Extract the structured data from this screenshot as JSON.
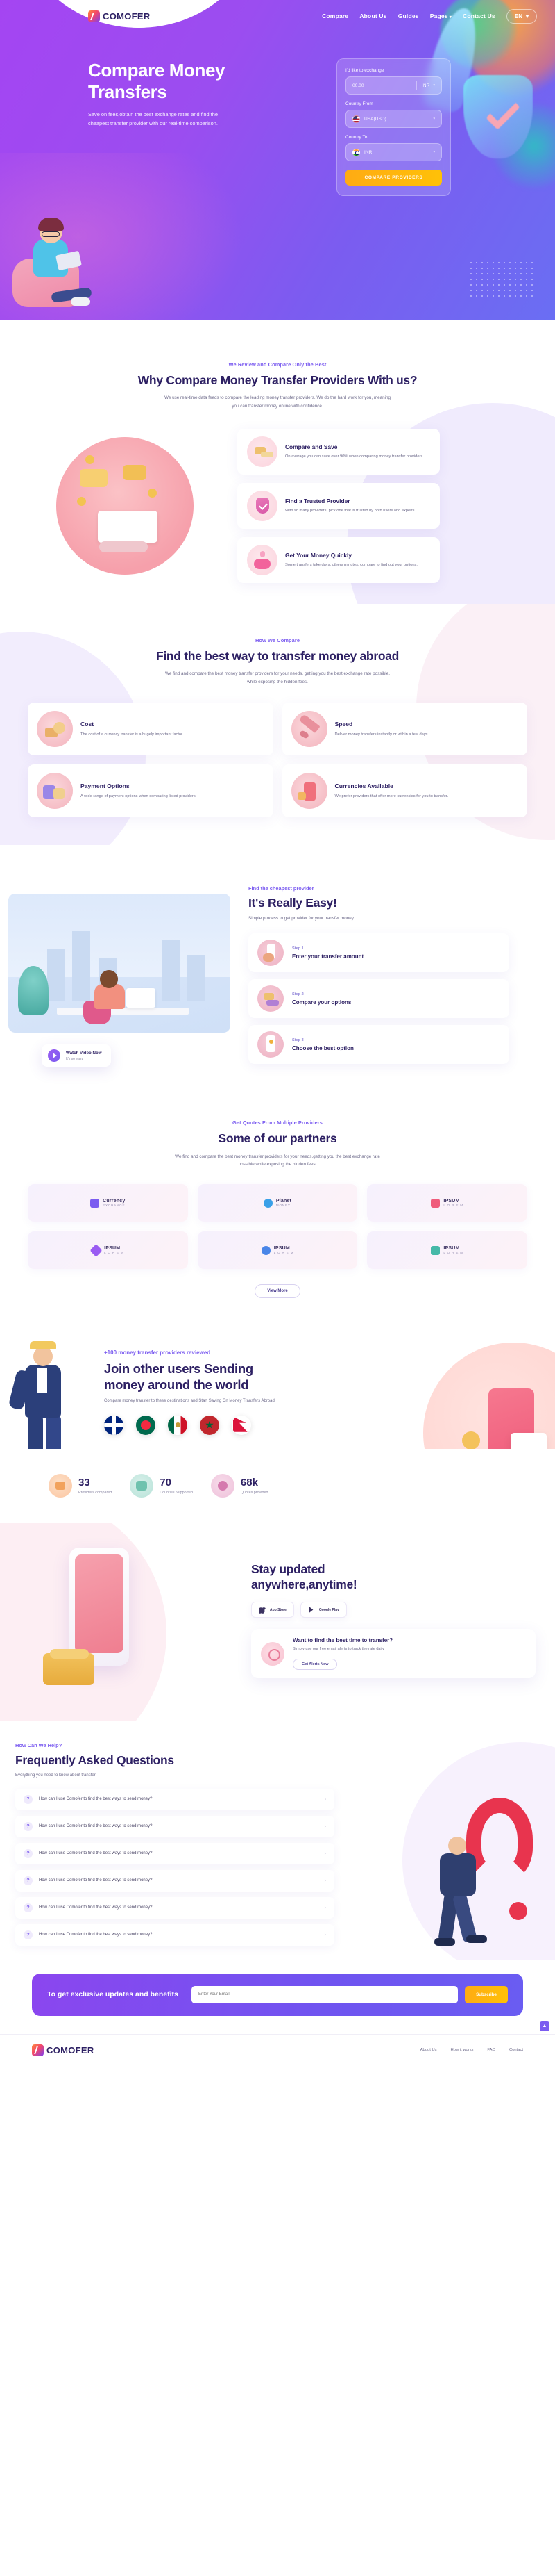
{
  "brand": {
    "name": "COMOFER"
  },
  "nav": {
    "links": [
      {
        "label": "Compare",
        "caret": false
      },
      {
        "label": "About Us",
        "caret": false
      },
      {
        "label": "Guides",
        "caret": false
      },
      {
        "label": "Pages",
        "caret": true
      },
      {
        "label": "Contact Us",
        "caret": false
      }
    ],
    "language": "EN",
    "language_caret": "▾"
  },
  "hero": {
    "title_line1": "Compare Money",
    "title_line2": "Transfers",
    "subtitle": "Save on fees,obtain the best exchange rates and find the cheapest transfer provider with our real-time comparison.",
    "form": {
      "exchange_label": "I'd like to exchange",
      "amount_value": "00.00",
      "amount_currency": "INR",
      "country_from_label": "Country From",
      "country_from_value": "USA(USD)",
      "country_to_label": "Country To",
      "country_to_value": "INR",
      "submit_label": "COMPARE PROVIDERS"
    }
  },
  "why": {
    "eyebrow": "We Review and Compare Only the Best",
    "title": "Why Compare Money Transfer Providers With us?",
    "lead": "We use real-time data feeds to compare the leading money transfer providers. We do the hard work for you, meaning you can transfer money online with confidence.",
    "cards": [
      {
        "title": "Compare and Save",
        "desc": "On average you can save over 90% when comparing money transfer providers.",
        "icon": "coins-icon"
      },
      {
        "title": "Find a Trusted Provider",
        "desc": "With so many providers, pick one that is trusted by both users and experts.",
        "icon": "shield-check-icon"
      },
      {
        "title": "Get Your Money Quickly",
        "desc": "Some transfers take days, others minutes, compare to find out your options.",
        "icon": "piggy-bank-icon"
      }
    ]
  },
  "how": {
    "eyebrow": "How We Compare",
    "title": "Find the best way to transfer money abroad",
    "lead": "We find and compare the best money transfer providers for your needs, getting you the best exchange rate possible, while exposing the hidden fees.",
    "cards": [
      {
        "title": "Cost",
        "desc": "The cost of a currency transfer is a hugely important factor",
        "icon": "coin-stack-icon"
      },
      {
        "title": "Speed",
        "desc": "Deliver money transfers instantly or within a few days.",
        "icon": "rocket-icon"
      },
      {
        "title": "Payment Options",
        "desc": "A wide range of payment options when comparing listed providers.",
        "icon": "wallet-icon"
      },
      {
        "title": "Currencies Available",
        "desc": "We prefer providers that offer more currencies for you to transfer.",
        "icon": "currency-icon"
      }
    ]
  },
  "easy": {
    "eyebrow": "Find the cheapest provider",
    "title": "It's Really Easy!",
    "lead": "Simple process to get provider for your transfer money",
    "video": {
      "title": "Watch Video Now",
      "subtitle": "It's so easy"
    },
    "steps": [
      {
        "num": "Step 1",
        "title": "Enter your transfer amount"
      },
      {
        "num": "Step 2",
        "title": "Compare your options"
      },
      {
        "num": "Step 3",
        "title": "Choose the best option"
      }
    ]
  },
  "partners": {
    "eyebrow": "Get Quotes From Multiple Providers",
    "title": "Some of our partners",
    "lead": "We find and compare the best money transfer providers for your needs,getting you the best exchange rate possible,while exposing the hidden fees.",
    "logos": [
      {
        "name": "Currency",
        "sub": "EXCHANGE",
        "color": "#7b5cf0"
      },
      {
        "name": "Planet",
        "sub": "MONEY",
        "color": "#3aa0e8"
      },
      {
        "name": "IPSUM",
        "sub": "L O R E M",
        "color": "#ef5c7b"
      },
      {
        "name": "IPSUM",
        "sub": "L O R E M",
        "color": "#9a5cf2"
      },
      {
        "name": "IPSUM",
        "sub": "L O R E M",
        "color": "#4a86e8"
      },
      {
        "name": "IPSUM",
        "sub": "L O R E M",
        "color": "#46b9a8"
      }
    ],
    "view_more": "View More"
  },
  "join": {
    "eyebrow": "+100 money transfer providers reviewed",
    "title_line1": "Join other users Sending",
    "title_line2": "money around the world",
    "lead": "Compare money transfer to these destinations and Start Saving On Money Transfers Abroad!",
    "flags": [
      "United Kingdom",
      "Bangladesh",
      "Mexico",
      "Morocco",
      "Nepal"
    ]
  },
  "stats": [
    {
      "value": "33",
      "label": "Providers compared",
      "icon": "box-icon"
    },
    {
      "value": "70",
      "label": "Counties Supported",
      "icon": "globe-icon"
    },
    {
      "value": "68k",
      "label": "Quotes provided",
      "icon": "quote-icon"
    }
  ],
  "stay": {
    "title_line1": "Stay updated",
    "title_line2": "anywhere,anytime!",
    "badges": [
      {
        "label": "App Store",
        "icon": "apple-icon"
      },
      {
        "label": "Google Play",
        "icon": "play-store-icon"
      }
    ],
    "cta": {
      "title": "Want to find the best time to transfer?",
      "desc": "Simply use our free email alerts to track the rate daily",
      "button": "Get Alerts Now"
    }
  },
  "faq": {
    "eyebrow": "How Can We Help?",
    "title": "Frequently Asked Questions",
    "lead": "Everything you need to know about transfer",
    "items": [
      "How can I use Comofer to find the best ways to send money?",
      "How can I use Comofer to find the best ways to send money?",
      "How can I use Comofer to find the best ways to send money?",
      "How can I use Comofer to find the best ways to send money?",
      "How can I use Comofer to find the best ways to send money?",
      "How can I use Comofer to find the best ways to send money?"
    ],
    "chevron": "›"
  },
  "newsletter": {
    "title": "To get exclusive updates and benefits",
    "placeholder": "Enter Your Email",
    "button": "Subscribe"
  },
  "footer": {
    "links": [
      "About Us",
      "How it works",
      "FAQ",
      "Contact"
    ],
    "scroll_top": "▲"
  },
  "colors": {
    "primary": "#7b5cf0",
    "dark": "#2d2063",
    "accent": "#ffab13",
    "pink": "#ef5c7b"
  }
}
